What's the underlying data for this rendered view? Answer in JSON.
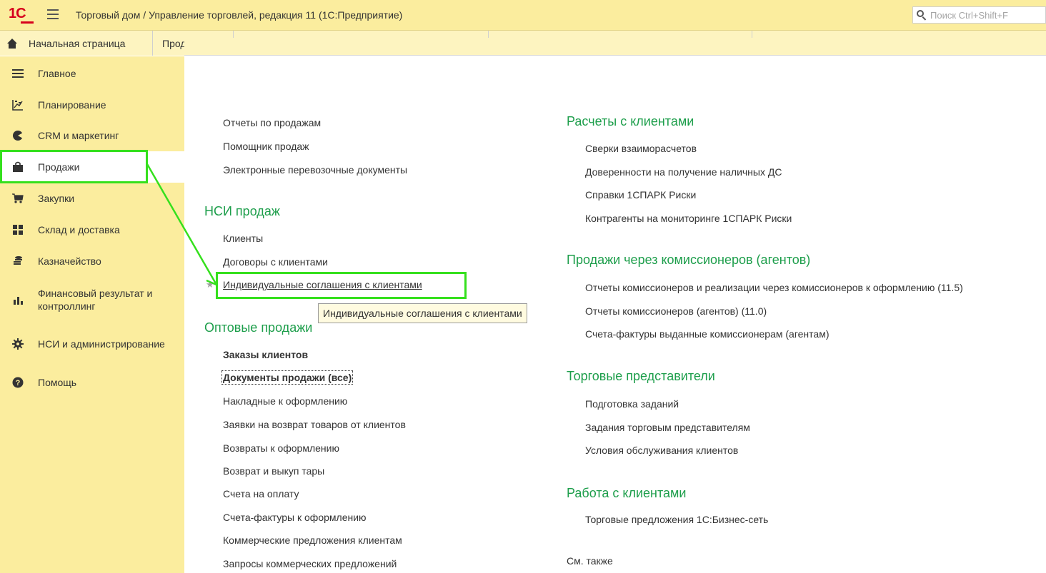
{
  "window": {
    "logo_text": "1С",
    "title": "Торговый дом / Управление торговлей, редакция 11  (1С:Предприятие)",
    "search_placeholder": "Поиск Ctrl+Shift+F"
  },
  "tabs": {
    "home_label": "Начальная страница",
    "partial_label": "Прод"
  },
  "sidebar": {
    "items": [
      {
        "label": "Главное",
        "icon": "list-icon"
      },
      {
        "label": "Планирование",
        "icon": "chart-planning-icon"
      },
      {
        "label": "CRM и маркетинг",
        "icon": "crm-icon"
      },
      {
        "label": "Продажи",
        "icon": "bag-icon",
        "active": true
      },
      {
        "label": "Закупки",
        "icon": "cart-icon"
      },
      {
        "label": "Склад и доставка",
        "icon": "warehouse-icon"
      },
      {
        "label": "Казначейство",
        "icon": "coins-icon"
      },
      {
        "label": "Финансовый результат и контроллинг",
        "icon": "bar-chart-icon"
      },
      {
        "label": "НСИ и администрирование",
        "icon": "gear-icon"
      },
      {
        "label": "Помощь",
        "icon": "help-icon"
      }
    ]
  },
  "content": {
    "left_top_links": [
      "Отчеты по продажам",
      "Помощник продаж",
      "Электронные перевозочные документы"
    ],
    "nsi": {
      "title": "НСИ продаж",
      "links": [
        "Клиенты",
        "Договоры с клиентами",
        "Индивидуальные соглашения с клиентами"
      ]
    },
    "tooltip": "Индивидуальные соглашения с клиентами",
    "wholesale": {
      "title": "Оптовые продажи",
      "links": [
        "Заказы клиентов",
        "Документы продажи (все)",
        "Накладные к оформлению",
        "Заявки на возврат товаров от клиентов",
        "Возвраты к оформлению",
        "Возврат и выкуп тары",
        "Счета на оплату",
        "Счета-фактуры к оформлению",
        "Коммерческие предложения клиентам",
        "Запросы коммерческих предложений"
      ]
    },
    "settlements": {
      "title": "Расчеты с клиентами",
      "links": [
        "Сверки взаиморасчетов",
        "Доверенности на получение наличных ДС",
        "Справки 1СПАРК Риски",
        "Контрагенты на мониторинге 1СПАРК Риски"
      ]
    },
    "commission": {
      "title": "Продажи через комиссионеров (агентов)",
      "links": [
        "Отчеты комиссионеров и реализации через комиссионеров к оформлению (11.5)",
        "Отчеты комиссионеров (агентов) (11.0)",
        "Счета-фактуры выданные комиссионерам (агентам)"
      ]
    },
    "reps": {
      "title": "Торговые представители",
      "links": [
        "Подготовка заданий",
        "Задания торговым представителям",
        "Условия обслуживания клиентов"
      ]
    },
    "work": {
      "title": "Работа с клиентами",
      "links": [
        "Торговые предложения 1С:Бизнес-сеть"
      ]
    },
    "see_also": "См. также"
  },
  "colors": {
    "title_bar": "#fbed9e",
    "sidebar": "#fbed9e",
    "section_heading": "#1d9e4b",
    "annotation": "#35e01d",
    "logo": "#d6001c"
  }
}
